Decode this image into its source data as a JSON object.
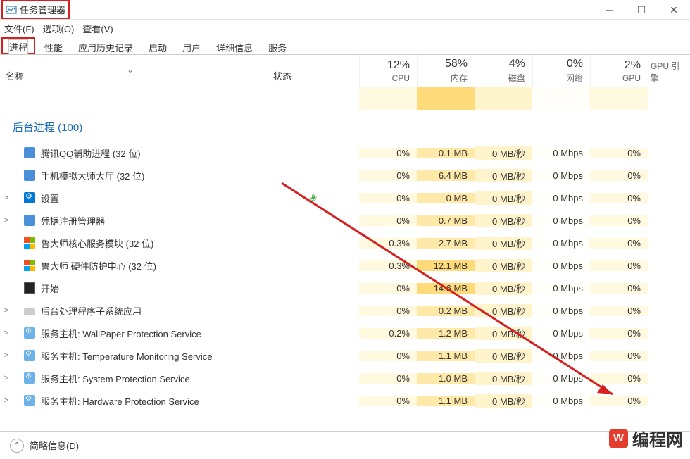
{
  "window": {
    "title": "任务管理器"
  },
  "menu": {
    "file": "文件(F)",
    "options": "选项(O)",
    "view": "查看(V)"
  },
  "tabs": [
    "进程",
    "性能",
    "应用历史记录",
    "启动",
    "用户",
    "详细信息",
    "服务"
  ],
  "columns": {
    "name": "名称",
    "status": "状态",
    "cpu": {
      "pct": "12%",
      "label": "CPU"
    },
    "mem": {
      "pct": "58%",
      "label": "内存"
    },
    "disk": {
      "pct": "4%",
      "label": "磁盘"
    },
    "net": {
      "pct": "0%",
      "label": "网络"
    },
    "gpu": {
      "pct": "2%",
      "label": "GPU"
    },
    "gpueng": "GPU 引擎"
  },
  "group": {
    "title": "后台进程 (100)"
  },
  "rows": [
    {
      "exp": "",
      "icon": "generic",
      "name": "腾讯QQ辅助进程 (32 位)",
      "leaf": false,
      "cpu": "0%",
      "mem": "0.1 MB",
      "disk": "0 MB/秒",
      "net": "0 Mbps",
      "gpu": "0%",
      "hotmem": false
    },
    {
      "exp": "",
      "icon": "generic",
      "name": "手机模拟大师大厅 (32 位)",
      "leaf": false,
      "cpu": "0%",
      "mem": "6.4 MB",
      "disk": "0 MB/秒",
      "net": "0 Mbps",
      "gpu": "0%",
      "hotmem": false
    },
    {
      "exp": ">",
      "icon": "gear",
      "name": "设置",
      "leaf": true,
      "cpu": "0%",
      "mem": "0 MB",
      "disk": "0 MB/秒",
      "net": "0 Mbps",
      "gpu": "0%",
      "hotmem": false
    },
    {
      "exp": ">",
      "icon": "generic",
      "name": "凭据注册管理器",
      "leaf": false,
      "cpu": "0%",
      "mem": "0.7 MB",
      "disk": "0 MB/秒",
      "net": "0 Mbps",
      "gpu": "0%",
      "hotmem": false
    },
    {
      "exp": "",
      "icon": "win",
      "name": "鲁大师核心服务模块 (32 位)",
      "leaf": false,
      "cpu": "0.3%",
      "mem": "2.7 MB",
      "disk": "0 MB/秒",
      "net": "0 Mbps",
      "gpu": "0%",
      "hotmem": false
    },
    {
      "exp": "",
      "icon": "win",
      "name": "鲁大师 硬件防护中心 (32 位)",
      "leaf": false,
      "cpu": "0.3%",
      "mem": "12.1 MB",
      "disk": "0 MB/秒",
      "net": "0 Mbps",
      "gpu": "0%",
      "hotmem": true
    },
    {
      "exp": "",
      "icon": "start",
      "name": "开始",
      "leaf": false,
      "cpu": "0%",
      "mem": "14.6 MB",
      "disk": "0 MB/秒",
      "net": "0 Mbps",
      "gpu": "0%",
      "hotmem": true
    },
    {
      "exp": ">",
      "icon": "disk",
      "name": "后台处理程序子系统应用",
      "leaf": false,
      "cpu": "0%",
      "mem": "0.2 MB",
      "disk": "0 MB/秒",
      "net": "0 Mbps",
      "gpu": "0%",
      "hotmem": false
    },
    {
      "exp": ">",
      "icon": "svc",
      "name": "服务主机: WallPaper Protection Service",
      "leaf": false,
      "cpu": "0.2%",
      "mem": "1.2 MB",
      "disk": "0 MB/秒",
      "net": "0 Mbps",
      "gpu": "0%",
      "hotmem": false
    },
    {
      "exp": ">",
      "icon": "svc",
      "name": "服务主机: Temperature Monitoring Service",
      "leaf": false,
      "cpu": "0%",
      "mem": "1.1 MB",
      "disk": "0 MB/秒",
      "net": "0 Mbps",
      "gpu": "0%",
      "hotmem": false
    },
    {
      "exp": ">",
      "icon": "svc",
      "name": "服务主机: System Protection Service",
      "leaf": false,
      "cpu": "0%",
      "mem": "1.0 MB",
      "disk": "0 MB/秒",
      "net": "0 Mbps",
      "gpu": "0%",
      "hotmem": false
    },
    {
      "exp": ">",
      "icon": "svc",
      "name": "服务主机: Hardware Protection Service",
      "leaf": false,
      "cpu": "0%",
      "mem": "1.1 MB",
      "disk": "0 MB/秒",
      "net": "0 Mbps",
      "gpu": "0%",
      "hotmem": false
    }
  ],
  "footer": {
    "label": "简略信息(D)"
  },
  "watermark": {
    "logo": "W",
    "text": "编程网"
  }
}
